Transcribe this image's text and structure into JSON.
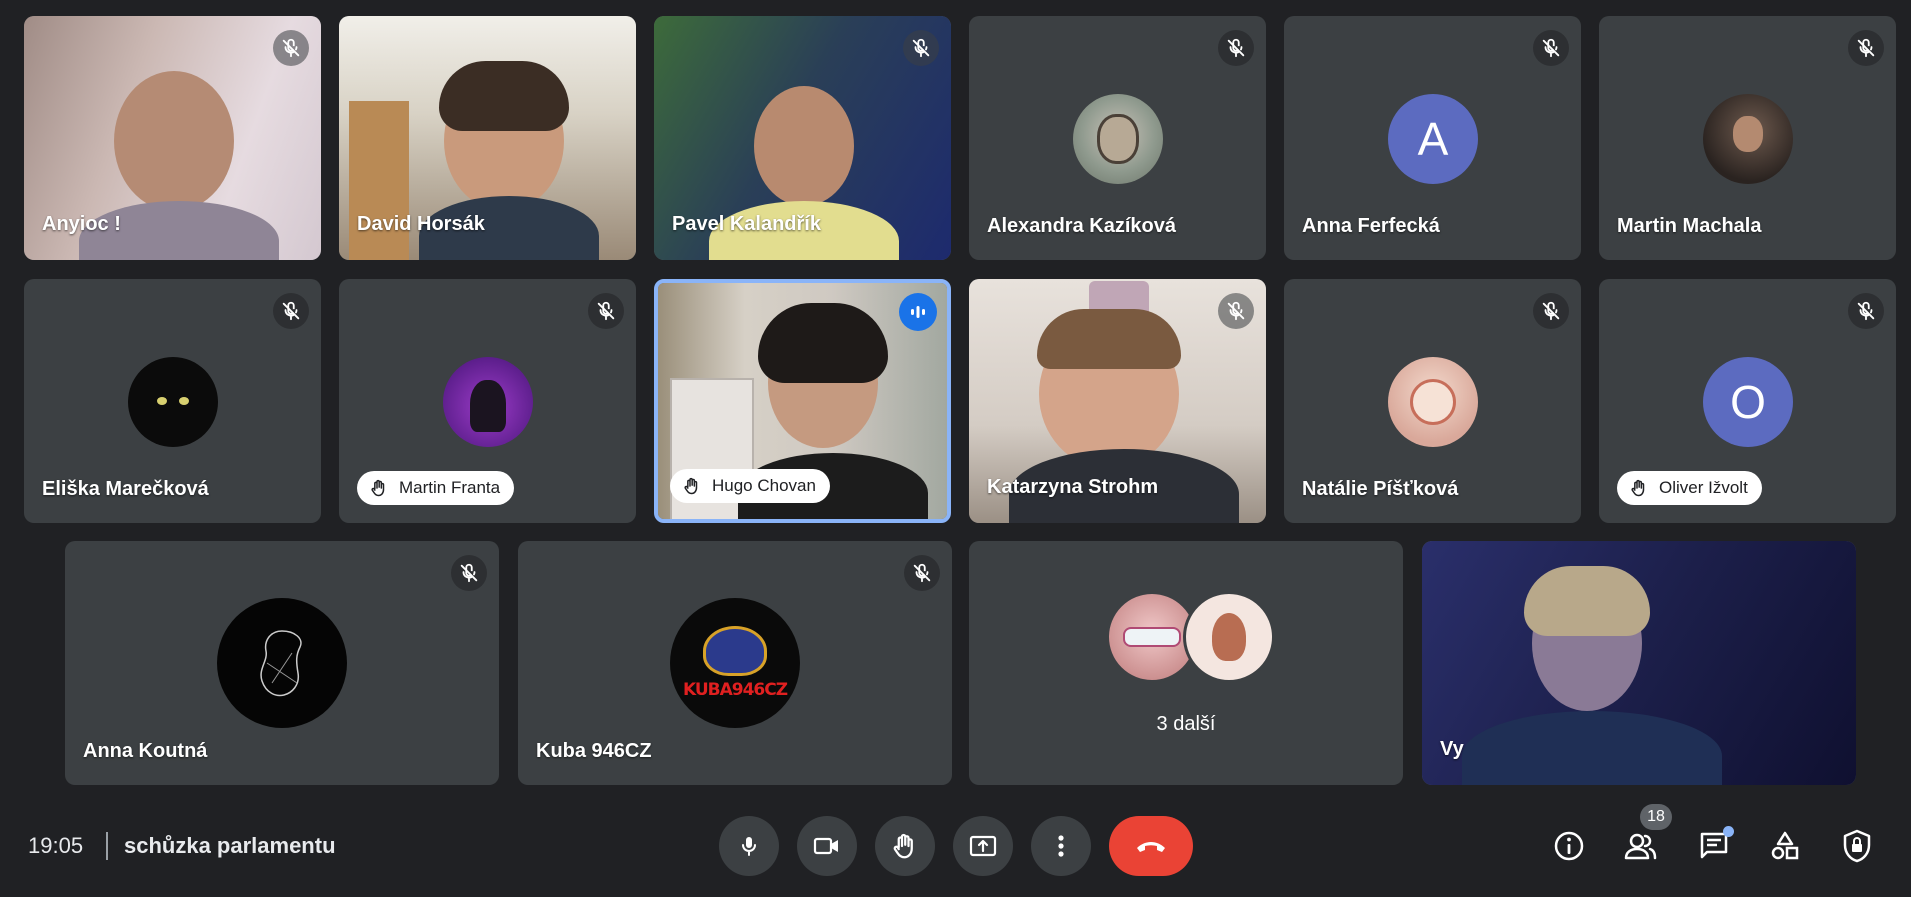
{
  "participants": {
    "anyioc": "Anyioc !",
    "david": "David Horsák",
    "pavel": "Pavel Kalandřík",
    "alexandra": "Alexandra Kazíková",
    "anna_f": "Anna Ferfecká",
    "anna_f_initial": "A",
    "martin_m": "Martin Machala",
    "eliska": "Eliška Marečková",
    "martin_f": "Martin Franta",
    "hugo": "Hugo Chovan",
    "katarzyna": "Katarzyna Strohm",
    "natalie": "Natálie Píšťková",
    "oliver": "Oliver Ižvolt",
    "oliver_initial": "O",
    "anna_k": "Anna Koutná",
    "kuba": "Kuba 946CZ",
    "kuba_logo_text": "KUBA946CZ",
    "others": "3 další",
    "self": "Vy"
  },
  "bottom_bar": {
    "time": "19:05",
    "meeting_title": "schůzka parlamentu",
    "people_count": "18"
  },
  "colors": {
    "background": "#202124",
    "tile": "#3c4043",
    "active_border": "#8ab4f8",
    "end_call": "#ea4335",
    "letter_avatar": "#5c6bc0"
  }
}
